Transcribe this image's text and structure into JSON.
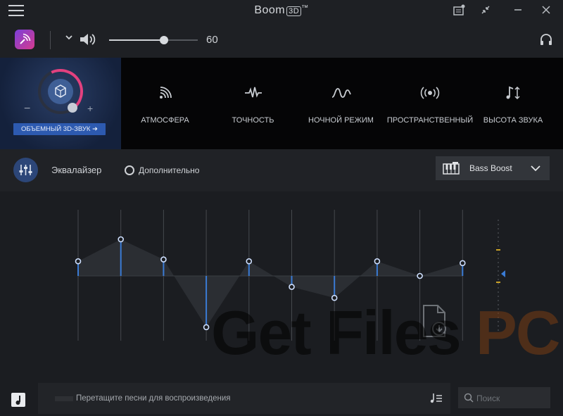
{
  "app": {
    "title": "Boom",
    "title_badge": "3D",
    "title_tm": "™"
  },
  "volume": {
    "value": 60,
    "label": "60"
  },
  "surround": {
    "label": "ОБЪЕМНЫЙ 3D-ЗВУК ➜",
    "minus": "−",
    "plus": "+"
  },
  "effects": [
    {
      "label": "АТМОСФЕРА",
      "icon": "ambience-icon"
    },
    {
      "label": "ТОЧНОСТЬ",
      "icon": "fidelity-icon"
    },
    {
      "label": "НОЧНОЙ РЕЖИМ",
      "icon": "night-mode-icon"
    },
    {
      "label": "ПРОСТРАНСТВЕННЫЙ",
      "icon": "spatial-icon"
    },
    {
      "label": "ВЫСОТА ЗВУКА",
      "icon": "pitch-icon"
    }
  ],
  "equalizer": {
    "label": "Эквалайзер",
    "advanced_label": "Дополнительно",
    "preset": "Bass Boost",
    "bands": [
      0.4,
      1.0,
      0.45,
      -1.4,
      0.4,
      -0.3,
      -0.6,
      0.4,
      0.0,
      0.35
    ]
  },
  "watermark": {
    "text_main": "Get Files ",
    "text_accent": "PC"
  },
  "bottom": {
    "drop_text": "Перетащите песни для воспроизведения",
    "search_placeholder": "Поиск"
  },
  "colors": {
    "accent": "#3a7bd5",
    "surround_button": "#2d5ab0",
    "ring": "#e2417f"
  }
}
